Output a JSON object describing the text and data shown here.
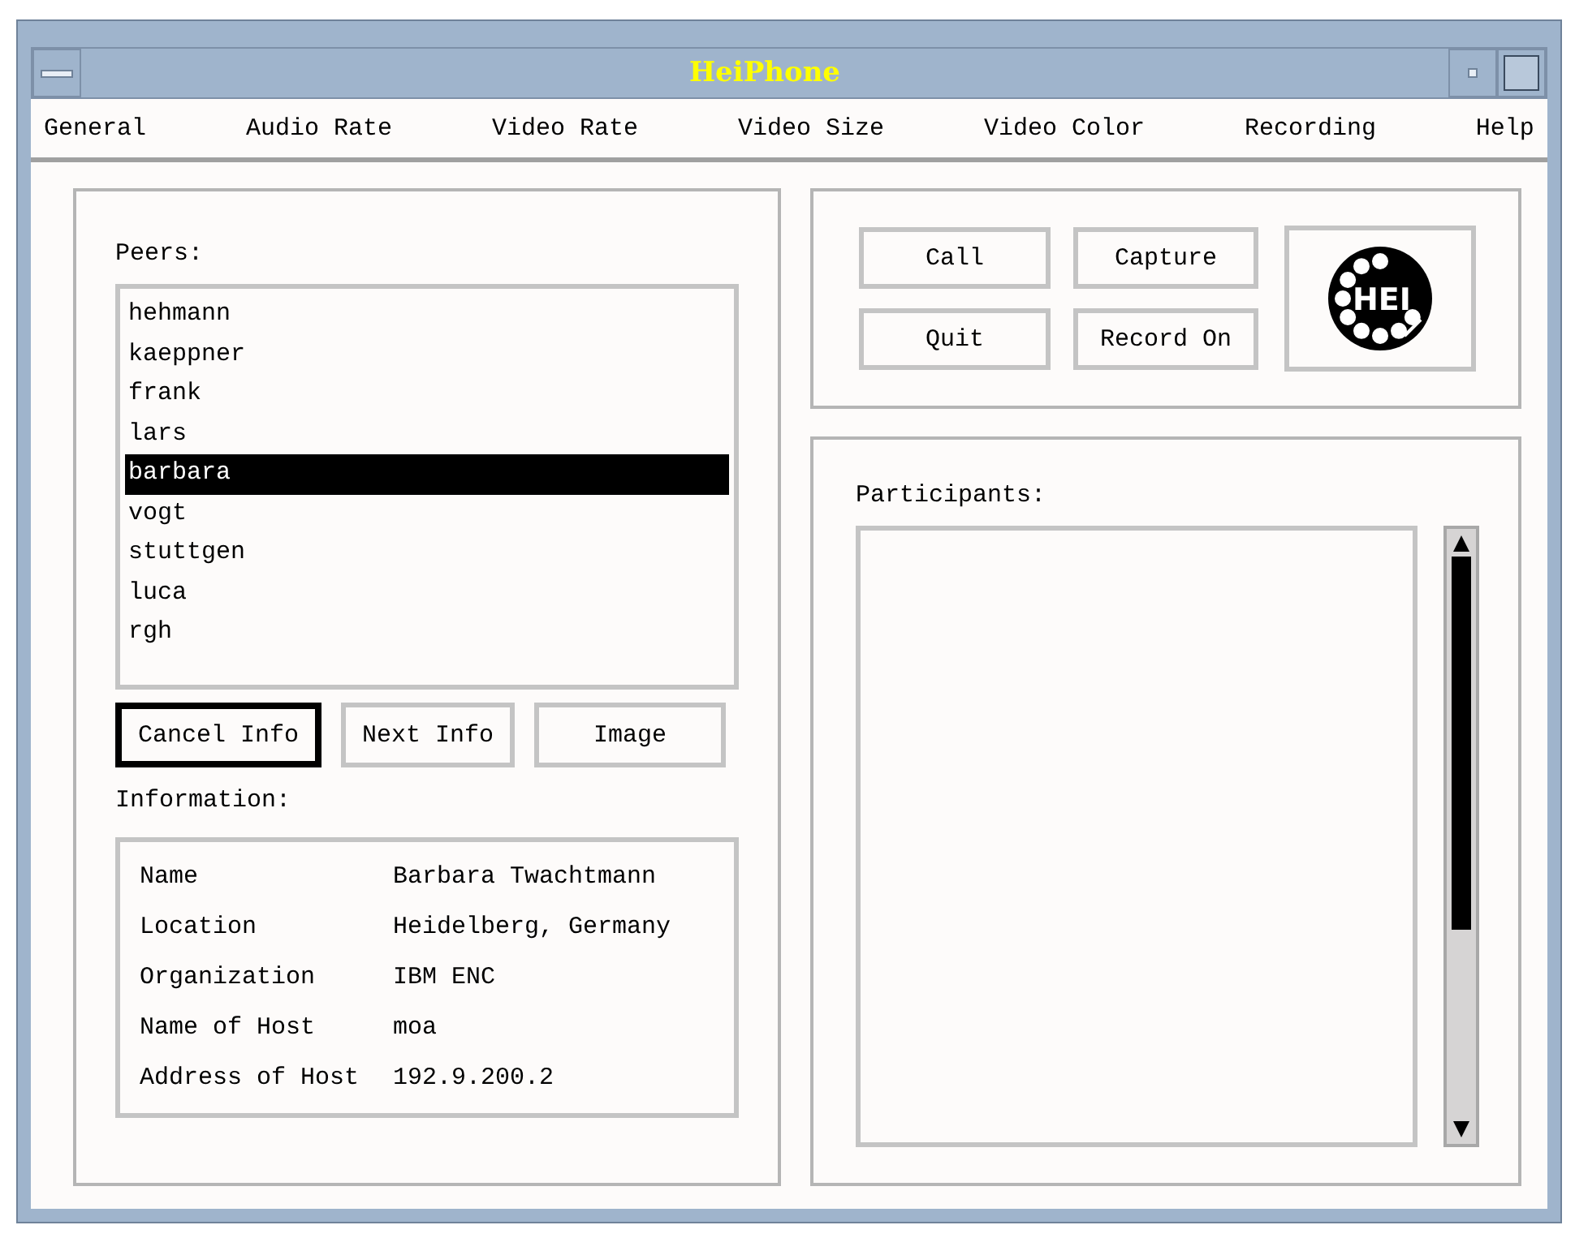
{
  "window": {
    "title": "HeiPhone"
  },
  "menu": [
    {
      "label": "General"
    },
    {
      "label": "Audio Rate"
    },
    {
      "label": "Video Rate"
    },
    {
      "label": "Video Size"
    },
    {
      "label": "Video Color"
    },
    {
      "label": "Recording"
    },
    {
      "label": "Help"
    }
  ],
  "peers": {
    "label": "Peers:",
    "items": [
      {
        "name": "hehmann",
        "selected": false
      },
      {
        "name": "kaeppner",
        "selected": false
      },
      {
        "name": "frank",
        "selected": false
      },
      {
        "name": "lars",
        "selected": false
      },
      {
        "name": "barbara",
        "selected": true
      },
      {
        "name": "vogt",
        "selected": false
      },
      {
        "name": "stuttgen",
        "selected": false
      },
      {
        "name": "luca",
        "selected": false
      },
      {
        "name": "rgh",
        "selected": false
      }
    ]
  },
  "info_buttons": [
    {
      "label": "Cancel Info",
      "default": true
    },
    {
      "label": "Next Info",
      "default": false
    },
    {
      "label": "Image",
      "default": false
    }
  ],
  "information": {
    "label": "Information:",
    "rows": [
      {
        "field": "Name",
        "value": "Barbara Twachtmann"
      },
      {
        "field": "Location",
        "value": "Heidelberg, Germany"
      },
      {
        "field": "Organization",
        "value": "IBM ENC"
      },
      {
        "field": "Name of Host",
        "value": "moa"
      },
      {
        "field": "Address of Host",
        "value": "192.9.200.2"
      }
    ]
  },
  "call_buttons": [
    {
      "label": "Call"
    },
    {
      "label": "Capture"
    },
    {
      "label": "Quit"
    },
    {
      "label": "Record On"
    }
  ],
  "logo": {
    "text": "HEI"
  },
  "participants": {
    "label": "Participants:"
  }
}
